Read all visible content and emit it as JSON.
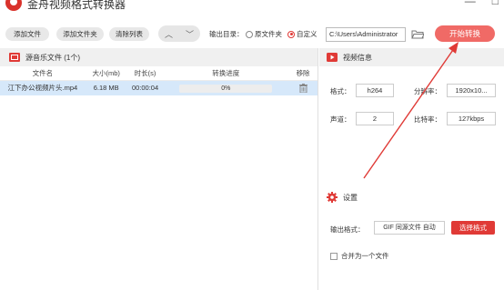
{
  "window": {
    "title": "金舟视频格式转换器",
    "controls": [
      "—",
      "□"
    ]
  },
  "toolbar": {
    "add_file": "添加文件",
    "add_folder": "添加文件夹",
    "clear_list": "清除列表",
    "up_arrow": "︿",
    "down_arrow": "﹀",
    "output_dir_label": "输出目录：",
    "radio_source_folder": "原文件夹",
    "radio_custom": "自定义",
    "selected_radio": "custom",
    "output_path": "C:\\Users\\Administrator",
    "start_convert": "开始转换"
  },
  "file_list": {
    "header": "源音乐文件 (1个)",
    "columns": [
      "文件名",
      "大小(mb)",
      "时长(s)",
      "转换进度",
      "移除"
    ],
    "rows": [
      {
        "name": "江下办公视频片头.mp4",
        "size": "6.18 MB",
        "duration": "00:00:04",
        "progress_text": "0%",
        "progress": 0
      }
    ]
  },
  "video_info": {
    "header": "视频信息",
    "format_label": "格式：",
    "format_value": "h264",
    "resolution_label": "分辨率：",
    "resolution_value": "1920x10...",
    "channel_label": "声道：",
    "channel_value": "2",
    "bitrate_label": "比特率：",
    "bitrate_value": "127kbps"
  },
  "settings": {
    "header": "设置",
    "output_format_label": "输出格式：",
    "output_format_value": "GIF 同源文件 自动",
    "choose_format": "选择格式",
    "merge_label": "合并为一个文件",
    "merge_checked": false
  },
  "colors": {
    "accent": "#e03a36",
    "start_button": "#f06a66",
    "selected_row": "#d6e8fa",
    "annotation_arrow": "#e03a36"
  }
}
